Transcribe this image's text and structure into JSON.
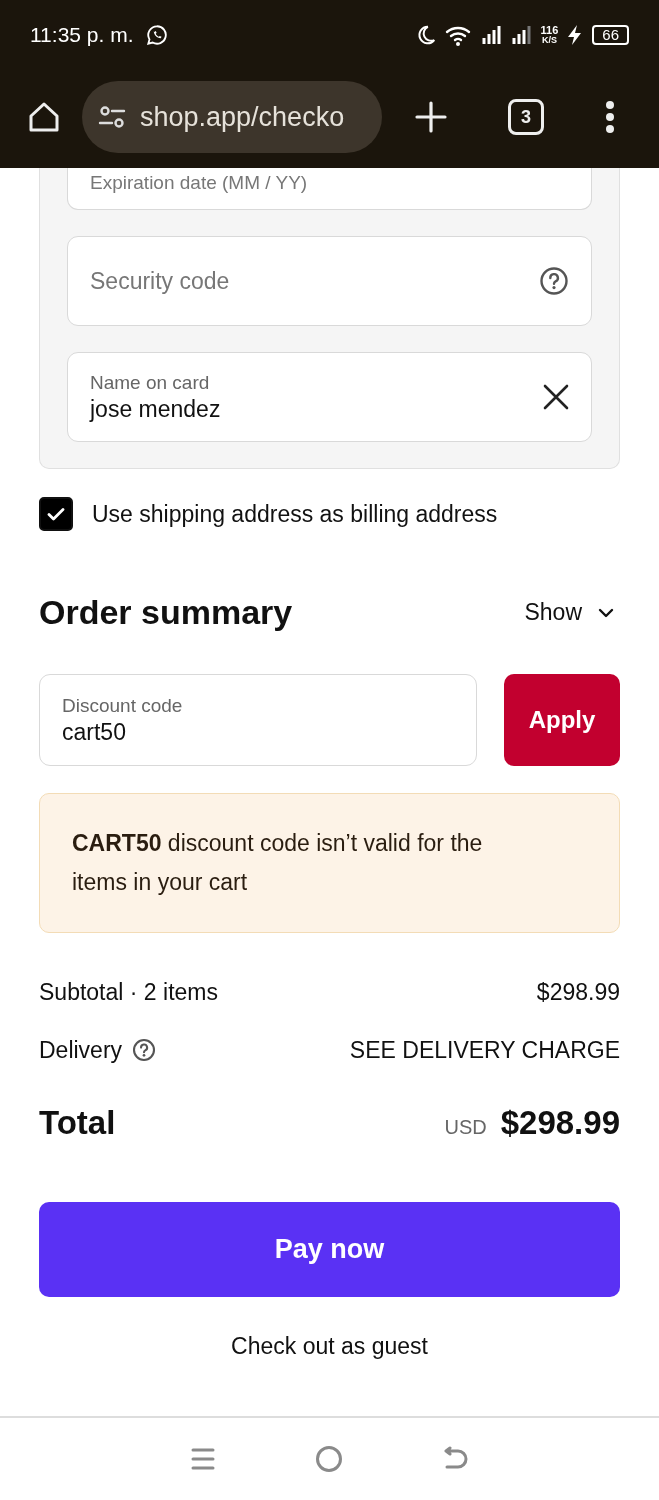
{
  "status_bar": {
    "time": "11:35 p. m.",
    "net_speed": "116",
    "net_unit": "K/S",
    "battery": "66"
  },
  "browser": {
    "url": "shop.app/checko",
    "tab_count": "3"
  },
  "card_fields": [
    {
      "kind": "placeholder",
      "placeholder": "Expiration date (MM / YY)"
    },
    {
      "kind": "help",
      "placeholder": "Security code"
    },
    {
      "kind": "clearable",
      "label": "Name on card",
      "value": "jose mendez"
    }
  ],
  "billing_checkbox": {
    "label": "Use shipping address as billing address",
    "checked": true
  },
  "order_summary": {
    "title": "Order summary",
    "toggle": "Show",
    "expanded": false
  },
  "discount": {
    "label": "Discount code",
    "value": "cart50",
    "button": "Apply"
  },
  "alert": {
    "text": "**CART50** discount code isn’t valid for the items in your cart"
  },
  "lines": [
    {
      "kind": "plain",
      "label": "Subtotal · 2 items",
      "value": "$298.99"
    },
    {
      "kind": "help",
      "label": "Delivery",
      "value": "SEE DELIVERY CHARGE"
    }
  ],
  "total": {
    "label": "Total",
    "currency": "USD",
    "value": "$298.99"
  },
  "pay_button": "Pay now",
  "guest_link": "Check out as guest"
}
